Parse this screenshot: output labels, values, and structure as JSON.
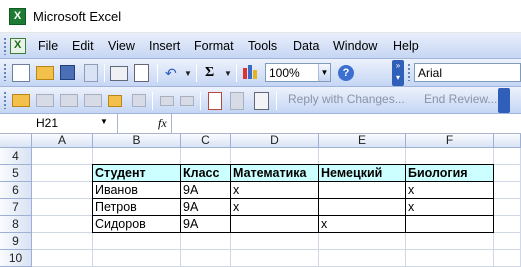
{
  "window": {
    "title": "Microsoft Excel"
  },
  "menu": {
    "items": [
      {
        "label": "File"
      },
      {
        "label": "Edit"
      },
      {
        "label": "View"
      },
      {
        "label": "Insert"
      },
      {
        "label": "Format"
      },
      {
        "label": "Tools"
      },
      {
        "label": "Data"
      },
      {
        "label": "Window"
      },
      {
        "label": "Help"
      }
    ]
  },
  "toolbar": {
    "zoom": "100%",
    "font": "Arial",
    "reply_with_changes": "Reply with Changes...",
    "end_review": "End Review..."
  },
  "formula_bar": {
    "name_box": "H21",
    "fx": "fx",
    "formula": ""
  },
  "sheet": {
    "columns": [
      "A",
      "B",
      "C",
      "D",
      "E",
      "F"
    ],
    "rows": [
      "4",
      "5",
      "6",
      "7",
      "8",
      "9",
      "10"
    ],
    "table": {
      "header": [
        "Студент",
        "Класс",
        "Математика",
        "Немецкий",
        "Биология"
      ],
      "rows": [
        [
          "Иванов",
          "9А",
          "x",
          "",
          "x"
        ],
        [
          "Петров",
          "9А",
          "x",
          "",
          "x"
        ],
        [
          "Сидоров",
          "9А",
          "",
          "x",
          ""
        ]
      ]
    }
  },
  "colors": {
    "header_fill": "#ccffff",
    "toolbar_blue": "#c6d6f3"
  }
}
